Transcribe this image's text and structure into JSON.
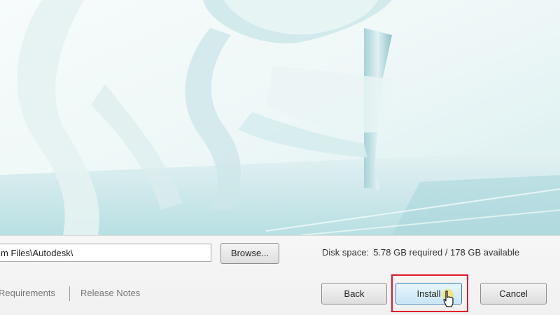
{
  "install_path": {
    "value": "m Files\\Autodesk\\"
  },
  "buttons": {
    "browse": "Browse...",
    "back": "Back",
    "install": "Install",
    "cancel": "Cancel"
  },
  "disk_space": {
    "label": "Disk space:",
    "value": "5.78 GB required / 178 GB available"
  },
  "links": {
    "requirements": "Requirements",
    "release_notes": "Release Notes"
  },
  "colors": {
    "highlight": "#e3152a",
    "hero_teal": "#9fd3d6"
  }
}
